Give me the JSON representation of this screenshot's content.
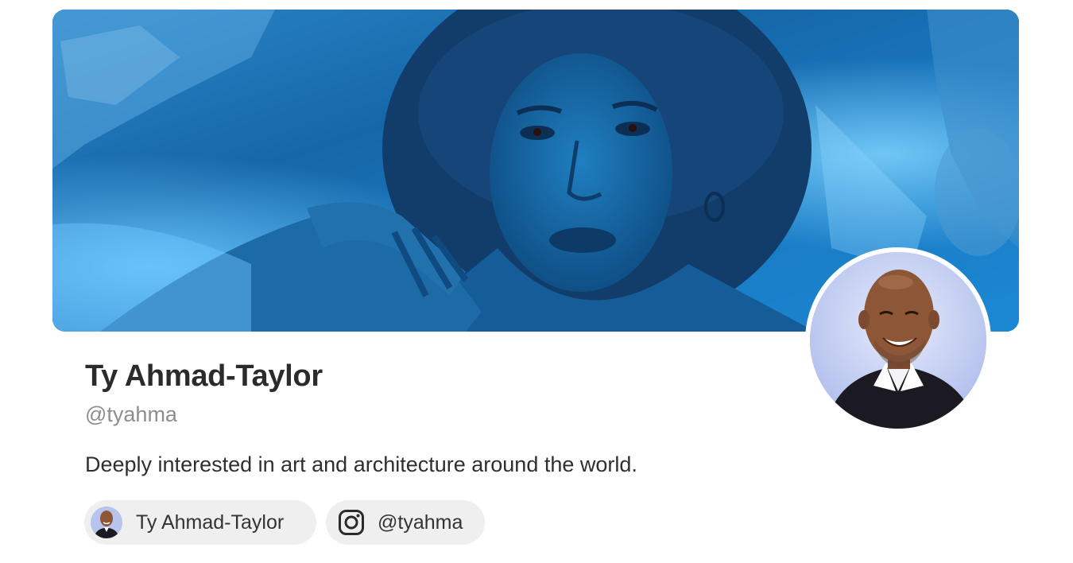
{
  "profile": {
    "name": "Ty Ahmad-Taylor",
    "handle": "@tyahma",
    "bio": "Deeply interested in art and architecture around the world."
  },
  "links": [
    {
      "label": "Ty Ahmad-Taylor",
      "icon": "profile-avatar-icon"
    },
    {
      "label": "@tyahma",
      "icon": "instagram-icon"
    }
  ],
  "colors": {
    "banner_blue": "#1a8ad6",
    "chip_background": "#efefef",
    "name_text": "#2b2b2b",
    "handle_text": "#8d8d92"
  }
}
